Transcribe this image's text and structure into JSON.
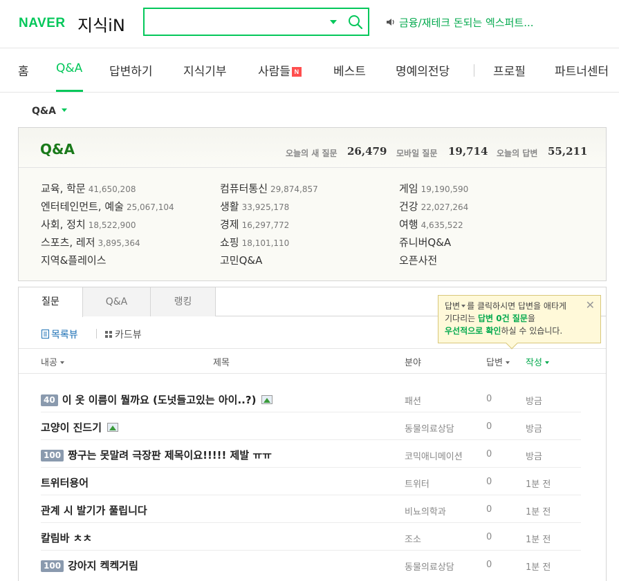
{
  "header": {
    "logo_naver": "NAVER",
    "logo_kin": "지식iN",
    "search_value": "",
    "notice": "금융/재테크 돈되는 엑스퍼트...",
    "colors": {
      "brand": "#03c75a"
    }
  },
  "nav": {
    "items": [
      "홈",
      "Q&A",
      "답변하기",
      "지식기부",
      "사람들",
      "베스트",
      "명예의전당",
      "프로필",
      "파트너센터"
    ],
    "active": "Q&A",
    "new_badge": "N"
  },
  "crumb": "Q&A",
  "qa": {
    "title": "Q&A",
    "stats": [
      {
        "label": "오늘의 새 질문",
        "value": "26,479"
      },
      {
        "label": "모바일 질문",
        "value": "19,714"
      },
      {
        "label": "오늘의 답변",
        "value": "55,211"
      }
    ],
    "categories": [
      [
        {
          "name": "교육, 학문",
          "count": "41,650,208"
        },
        {
          "name": "엔터테인먼트, 예술",
          "count": "25,067,104"
        },
        {
          "name": "사회, 정치",
          "count": "18,522,900"
        },
        {
          "name": "스포츠, 레저",
          "count": "3,895,364"
        },
        {
          "name": "지역&플레이스",
          "count": ""
        }
      ],
      [
        {
          "name": "컴퓨터통신",
          "count": "29,874,857"
        },
        {
          "name": "생활",
          "count": "33,925,178"
        },
        {
          "name": "경제",
          "count": "16,297,772"
        },
        {
          "name": "쇼핑",
          "count": "18,101,110"
        },
        {
          "name": "고민Q&A",
          "count": ""
        }
      ],
      [
        {
          "name": "게임",
          "count": "19,190,590"
        },
        {
          "name": "건강",
          "count": "22,027,264"
        },
        {
          "name": "여행",
          "count": "4,635,522"
        },
        {
          "name": "쥬니버Q&A",
          "count": ""
        },
        {
          "name": "오픈사전",
          "count": ""
        }
      ]
    ]
  },
  "list": {
    "tabs": [
      "질문",
      "Q&A",
      "랭킹"
    ],
    "views": [
      "목록뷰",
      "카드뷰"
    ],
    "columns": {
      "points": "내공",
      "title": "제목",
      "field": "분야",
      "answers": "답변",
      "time": "작성"
    },
    "rows": [
      {
        "points": "40",
        "title": "이 옷 이름이 뭘까요 (도넛들고있는 아이..?)",
        "has_image": true,
        "field": "패션",
        "answers": "0",
        "time": "방금"
      },
      {
        "points": "",
        "title": "고양이 진드기",
        "has_image": true,
        "field": "동물의료상담",
        "answers": "0",
        "time": "방금"
      },
      {
        "points": "100",
        "title": "짱구는 못말려 극장판 제목이요!!!!! 제발 ㅠㅠ",
        "has_image": false,
        "field": "코믹애니메이션",
        "answers": "0",
        "time": "방금"
      },
      {
        "points": "",
        "title": "트위터용어",
        "has_image": false,
        "field": "트위터",
        "answers": "0",
        "time": "1분 전"
      },
      {
        "points": "",
        "title": "관계 시 발기가 풀립니다",
        "has_image": false,
        "field": "비뇨의학과",
        "answers": "0",
        "time": "1분 전"
      },
      {
        "points": "",
        "title": "칼림바 ㅊㅊ",
        "has_image": false,
        "field": "조소",
        "answers": "0",
        "time": "1분 전"
      },
      {
        "points": "100",
        "title": "강아지 켁켁거림",
        "has_image": false,
        "field": "동물의료상담",
        "answers": "0",
        "time": "1분 전"
      }
    ]
  },
  "tooltip": {
    "t1": "답변",
    "t2": "를 클릭하시면 답변을 애타게",
    "t3": "기다리는 ",
    "t4": "답변 0건 질문",
    "t5": "을",
    "t6": "우선적으로 확인",
    "t7": "하실 수 있습니다."
  }
}
